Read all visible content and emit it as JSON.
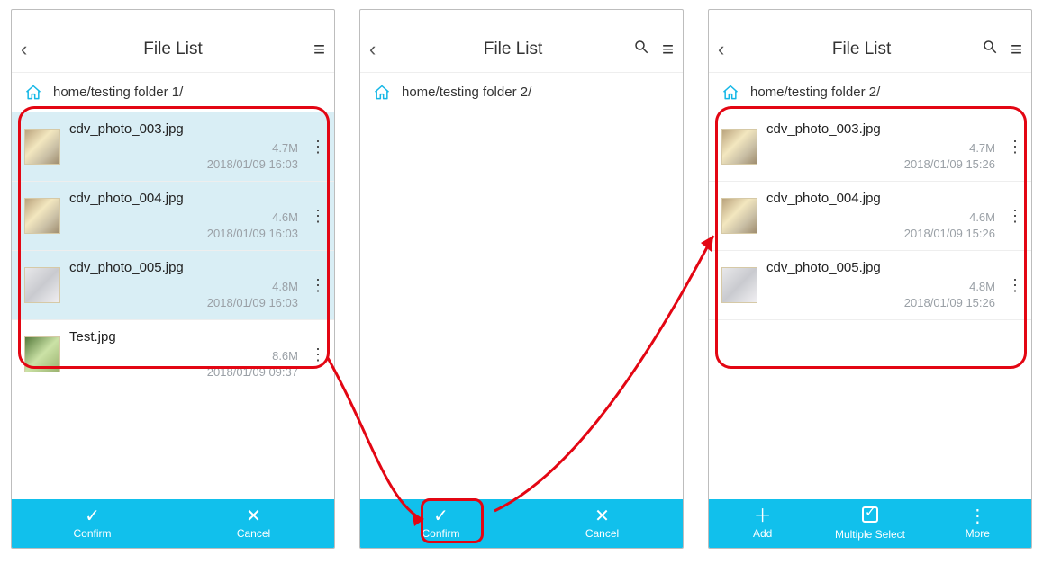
{
  "screens": {
    "s1": {
      "title": "File List",
      "showSearch": false,
      "path": "home/testing folder 1/",
      "files": [
        {
          "name": "cdv_photo_003.jpg",
          "size": "4.7M",
          "date": "2018/01/09 16:03",
          "sel": true,
          "thumb": "box"
        },
        {
          "name": "cdv_photo_004.jpg",
          "size": "4.6M",
          "date": "2018/01/09 16:03",
          "sel": true,
          "thumb": "box"
        },
        {
          "name": "cdv_photo_005.jpg",
          "size": "4.8M",
          "date": "2018/01/09 16:03",
          "sel": true,
          "thumb": "desk"
        },
        {
          "name": "Test.jpg",
          "size": "8.6M",
          "date": "2018/01/09 09:37",
          "sel": false,
          "thumb": "plant"
        }
      ],
      "bottom": {
        "type": "two",
        "buttons": [
          {
            "icon": "✓",
            "label": "Confirm"
          },
          {
            "icon": "✕",
            "label": "Cancel"
          }
        ]
      }
    },
    "s2": {
      "title": "File List",
      "showSearch": true,
      "path": "home/testing folder 2/",
      "files": [],
      "bottom": {
        "type": "two",
        "buttons": [
          {
            "icon": "✓",
            "label": "Confirm"
          },
          {
            "icon": "✕",
            "label": "Cancel"
          }
        ]
      }
    },
    "s3": {
      "title": "File List",
      "showSearch": true,
      "path": "home/testing folder 2/",
      "files": [
        {
          "name": "cdv_photo_003.jpg",
          "size": "4.7M",
          "date": "2018/01/09 15:26",
          "sel": false,
          "thumb": "box"
        },
        {
          "name": "cdv_photo_004.jpg",
          "size": "4.6M",
          "date": "2018/01/09 15:26",
          "sel": false,
          "thumb": "box"
        },
        {
          "name": "cdv_photo_005.jpg",
          "size": "4.8M",
          "date": "2018/01/09 15:26",
          "sel": false,
          "thumb": "desk"
        }
      ],
      "bottom": {
        "type": "three",
        "buttons": [
          {
            "icon": "＋",
            "label": "Add"
          },
          {
            "icon": "box-check",
            "label": "Multiple Select"
          },
          {
            "icon": "⋮",
            "label": "More"
          }
        ]
      }
    }
  },
  "icons": {
    "back": "‹",
    "search": "⌕",
    "menu": "≡",
    "home": "⌂",
    "dots": "⋮"
  }
}
